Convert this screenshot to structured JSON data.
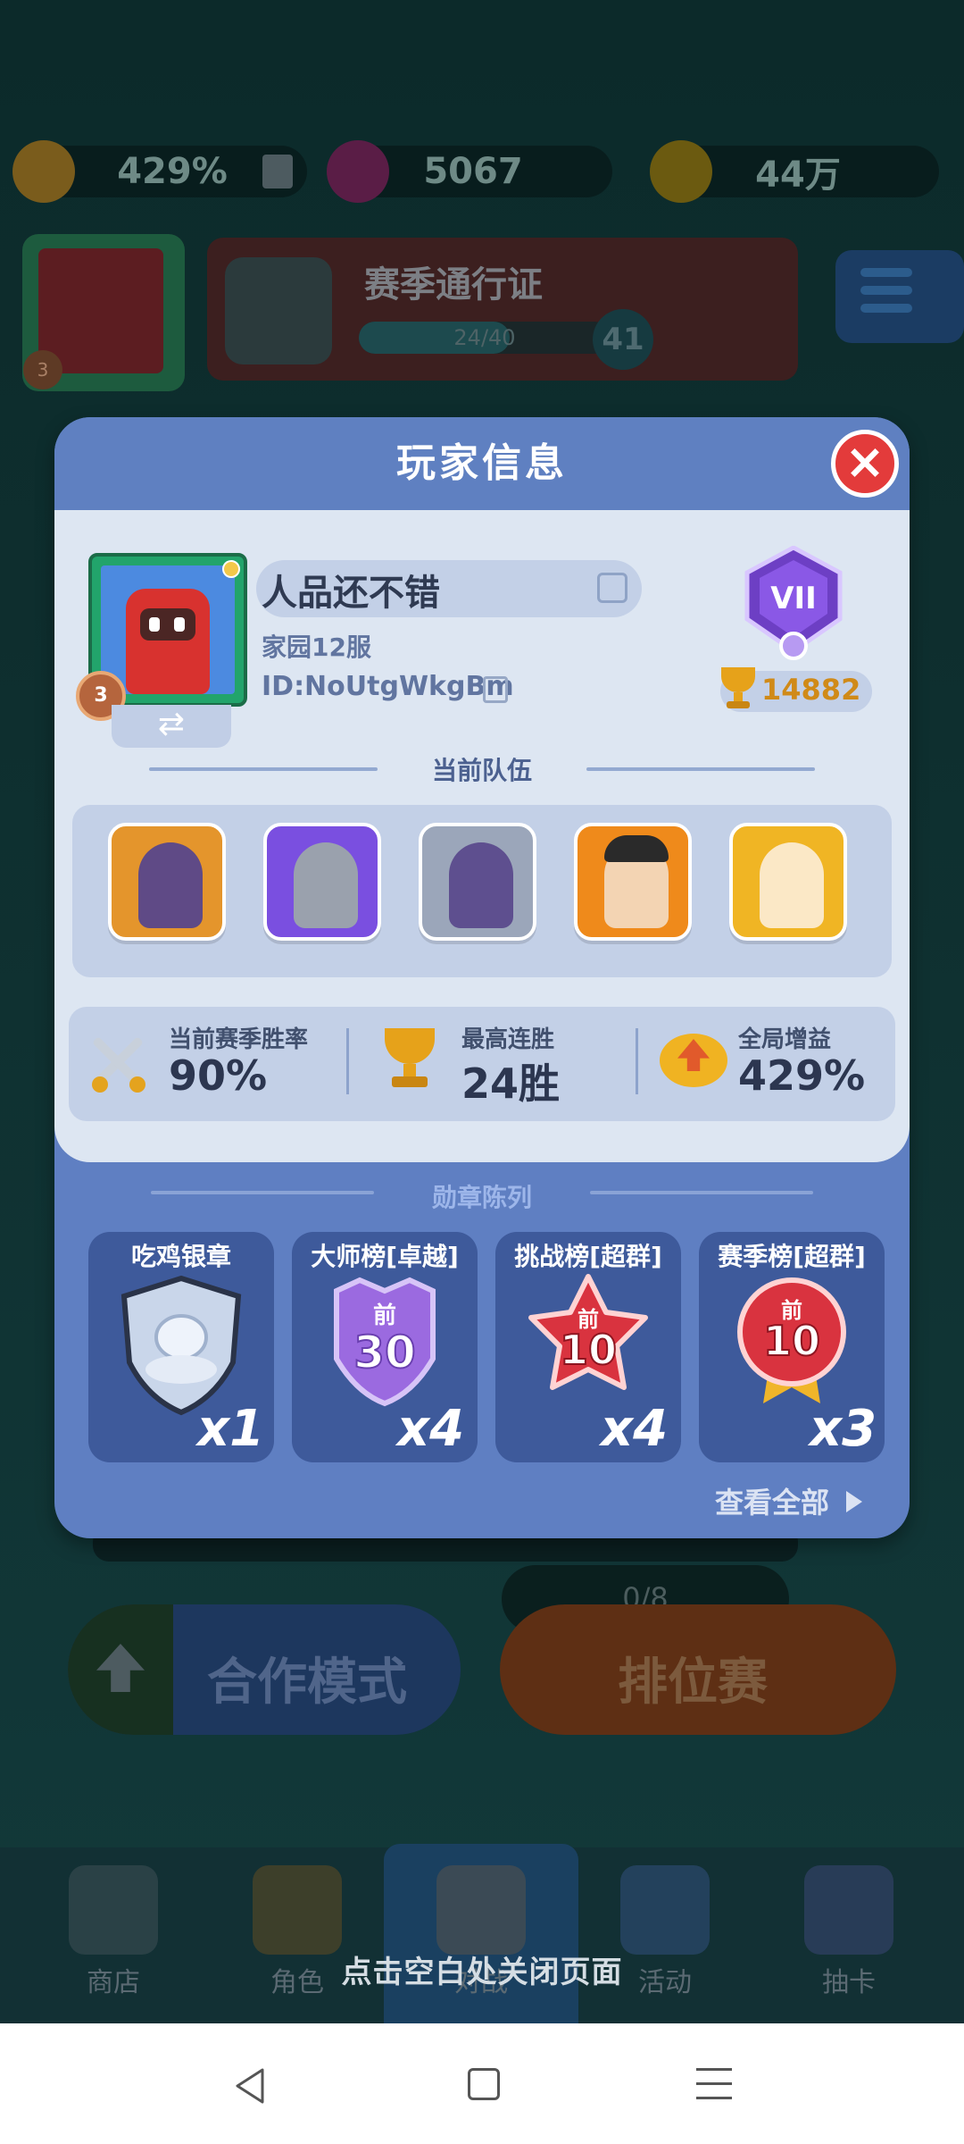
{
  "background": {
    "resources": [
      {
        "icon": "buff-crown-icon",
        "value": "429%",
        "color": "#e8a01a"
      },
      {
        "icon": "gem-icon",
        "value": "5067",
        "color": "#b9388f"
      },
      {
        "icon": "coin-icon",
        "value": "44万",
        "color": "#e6b716"
      }
    ],
    "season_pass": {
      "title": "赛季通行证",
      "progress": "24/40",
      "progress_fraction": 0.6,
      "level": "41"
    },
    "player_level": "3",
    "team_progress": "0/8",
    "mode_buttons": {
      "coop": "合作模式",
      "ranked": "排位赛"
    },
    "nav": [
      {
        "label": "商店",
        "icon": "shop-icon"
      },
      {
        "label": "角色",
        "icon": "character-icon"
      },
      {
        "label": "对战",
        "icon": "battle-icon"
      },
      {
        "label": "活动",
        "icon": "event-icon"
      },
      {
        "label": "抽卡",
        "icon": "gacha-icon"
      }
    ]
  },
  "dialog": {
    "title": "玩家信息",
    "player": {
      "name": "人品还不错",
      "server": "家园12服",
      "id": "ID:NoUtgWkgBm",
      "level": "3",
      "rank_roman": "VII",
      "trophies": "14882"
    },
    "team_section_title": "当前队伍",
    "team": [
      {
        "icon": "dark-elf-hero-icon",
        "color": "#e4952c"
      },
      {
        "icon": "knight-hero-icon",
        "color": "#7a4fe0"
      },
      {
        "icon": "ghost-hero-icon",
        "color": "#9ba6ba"
      },
      {
        "icon": "martial-artist-hero-icon",
        "color": "#ef8a1b"
      },
      {
        "icon": "angel-hero-icon",
        "color": "#f0b524"
      }
    ],
    "stats": [
      {
        "icon": "crossed-swords-icon",
        "label": "当前赛季胜率",
        "value": "90%"
      },
      {
        "icon": "trophy-icon",
        "label": "最高连胜",
        "value": "24胜"
      },
      {
        "icon": "global-buff-icon",
        "label": "全局增益",
        "value": "429%"
      }
    ],
    "medal_section_title": "勋章陈列",
    "medals": [
      {
        "name": "吃鸡银章",
        "count": "x1",
        "badge_text": "",
        "icon": "silver-shield-medal-icon"
      },
      {
        "name": "大师榜[卓越]",
        "count": "x4",
        "badge_top": "前",
        "badge_text": "30",
        "icon": "purple-rank-medal-icon"
      },
      {
        "name": "挑战榜[超群]",
        "count": "x4",
        "badge_top": "前",
        "badge_text": "10",
        "icon": "red-star-medal-icon"
      },
      {
        "name": "赛季榜[超群]",
        "count": "x3",
        "badge_top": "前",
        "badge_text": "10",
        "icon": "red-ribbon-medal-icon"
      }
    ],
    "view_all": "查看全部"
  },
  "close_hint": "点击空白处关闭页面"
}
